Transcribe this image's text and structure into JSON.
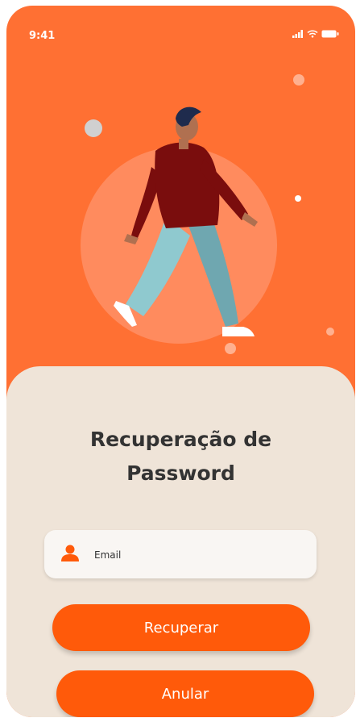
{
  "status_bar": {
    "time": "9:41",
    "icons": [
      "signal-icon",
      "wifi-icon",
      "battery-icon"
    ]
  },
  "colors": {
    "hero_background": "#ff7033",
    "sheet_background": "#efe4d8",
    "button": "#ff5a0a",
    "title_text": "#333333"
  },
  "illustration": "walking-person-illustration",
  "recover": {
    "title_line1": "Recuperação de",
    "title_line2": "Password",
    "email_placeholder": "Email",
    "email_value": "",
    "recover_button": "Recuperar",
    "cancel_button": "Anular"
  }
}
